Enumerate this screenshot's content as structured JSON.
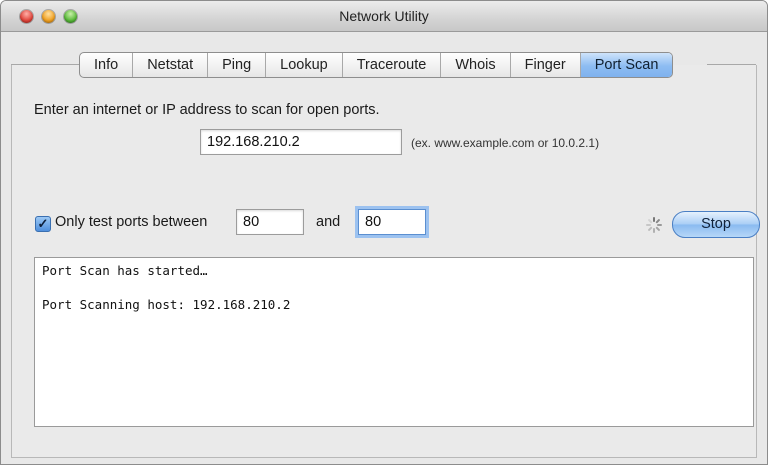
{
  "window": {
    "title": "Network Utility"
  },
  "tabs": [
    {
      "label": "Info"
    },
    {
      "label": "Netstat"
    },
    {
      "label": "Ping"
    },
    {
      "label": "Lookup"
    },
    {
      "label": "Traceroute"
    },
    {
      "label": "Whois"
    },
    {
      "label": "Finger"
    },
    {
      "label": "Port Scan"
    }
  ],
  "active_tab": "Port Scan",
  "form": {
    "prompt": "Enter an internet or IP address to scan for open ports.",
    "address_value": "192.168.210.2",
    "address_hint": "(ex. www.example.com or 10.0.2.1)",
    "only_test_ports_label": "Only test ports between",
    "only_test_ports_checked": true,
    "port_from": "80",
    "and_label": "and",
    "port_to": "80",
    "stop_label": "Stop"
  },
  "output": {
    "lines": [
      "Port Scan has started…",
      "",
      "Port Scanning host: 192.168.210.2"
    ]
  },
  "colors": {
    "active_tab": "#8dbcf2",
    "stop_button": "#a8cdf5",
    "focus_ring": "#9cc2f0"
  },
  "icons": {
    "checkbox": "checkmark-icon",
    "spinner": "progress-spinner-icon"
  }
}
